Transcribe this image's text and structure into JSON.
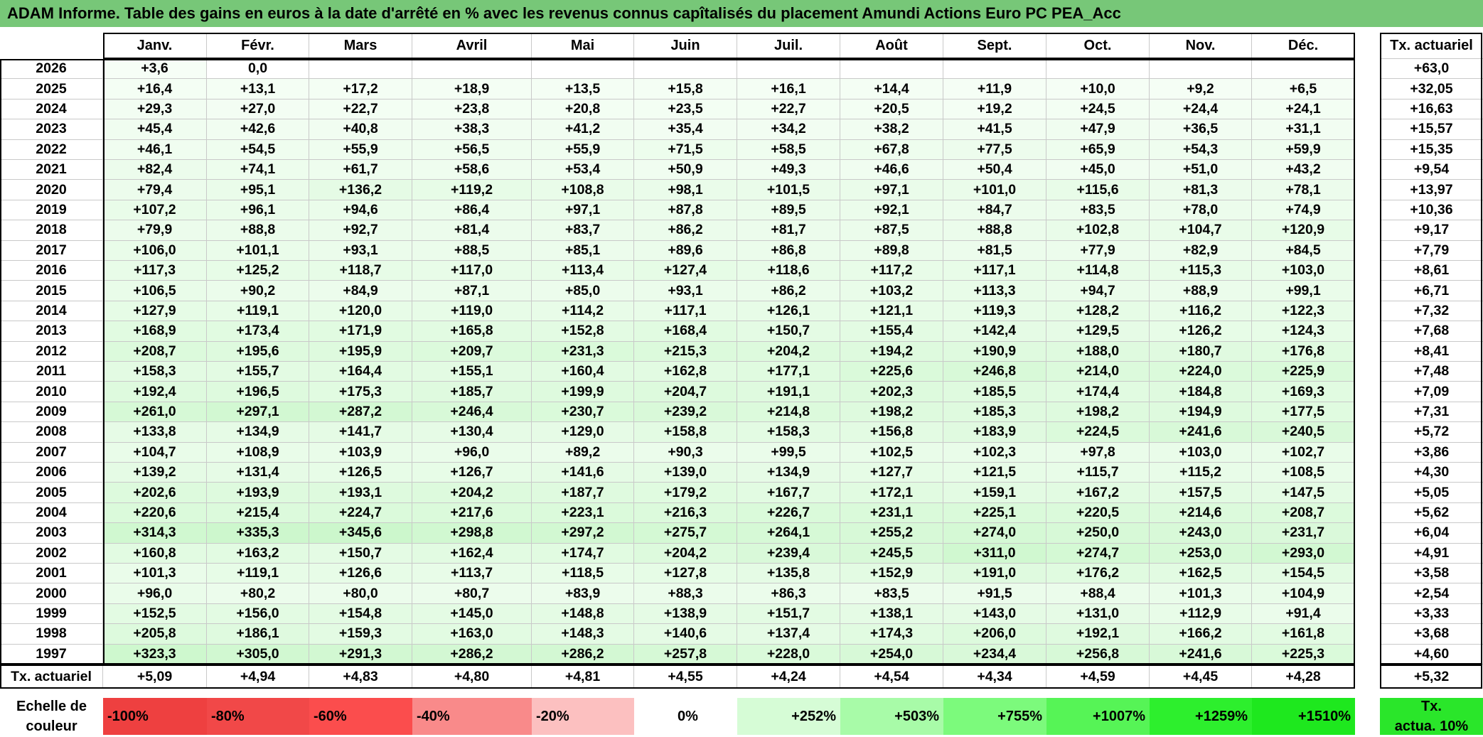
{
  "title": "ADAM Informe. Table des gains en euros à la date d'arrêté en % avec les revenus connus capîtalisés du placement Amundi Actions Euro PC PEA_Acc",
  "months": [
    "Janv.",
    "Févr.",
    "Mars",
    "Avril",
    "Mai",
    "Juin",
    "Juil.",
    "Août",
    "Sept.",
    "Oct.",
    "Nov.",
    "Déc."
  ],
  "rate_header": "Tx. actuariel",
  "footer_label": "Tx. actuariel",
  "rows": [
    {
      "year": "2026",
      "values": [
        "+3,6",
        "0,0",
        "",
        "",
        "",
        "",
        "",
        "",
        "",
        "",
        "",
        ""
      ],
      "rate": "+63,0"
    },
    {
      "year": "2025",
      "values": [
        "+16,4",
        "+13,1",
        "+17,2",
        "+18,9",
        "+13,5",
        "+15,8",
        "+16,1",
        "+14,4",
        "+11,9",
        "+10,0",
        "+9,2",
        "+6,5"
      ],
      "rate": "+32,05"
    },
    {
      "year": "2024",
      "values": [
        "+29,3",
        "+27,0",
        "+22,7",
        "+23,8",
        "+20,8",
        "+23,5",
        "+22,7",
        "+20,5",
        "+19,2",
        "+24,5",
        "+24,4",
        "+24,1"
      ],
      "rate": "+16,63"
    },
    {
      "year": "2023",
      "values": [
        "+45,4",
        "+42,6",
        "+40,8",
        "+38,3",
        "+41,2",
        "+35,4",
        "+34,2",
        "+38,2",
        "+41,5",
        "+47,9",
        "+36,5",
        "+31,1"
      ],
      "rate": "+15,57"
    },
    {
      "year": "2022",
      "values": [
        "+46,1",
        "+54,5",
        "+55,9",
        "+56,5",
        "+55,9",
        "+71,5",
        "+58,5",
        "+67,8",
        "+77,5",
        "+65,9",
        "+54,3",
        "+59,9"
      ],
      "rate": "+15,35"
    },
    {
      "year": "2021",
      "values": [
        "+82,4",
        "+74,1",
        "+61,7",
        "+58,6",
        "+53,4",
        "+50,9",
        "+49,3",
        "+46,6",
        "+50,4",
        "+45,0",
        "+51,0",
        "+43,2"
      ],
      "rate": "+9,54"
    },
    {
      "year": "2020",
      "values": [
        "+79,4",
        "+95,1",
        "+136,2",
        "+119,2",
        "+108,8",
        "+98,1",
        "+101,5",
        "+97,1",
        "+101,0",
        "+115,6",
        "+81,3",
        "+78,1"
      ],
      "rate": "+13,97"
    },
    {
      "year": "2019",
      "values": [
        "+107,2",
        "+96,1",
        "+94,6",
        "+86,4",
        "+97,1",
        "+87,8",
        "+89,5",
        "+92,1",
        "+84,7",
        "+83,5",
        "+78,0",
        "+74,9"
      ],
      "rate": "+10,36"
    },
    {
      "year": "2018",
      "values": [
        "+79,9",
        "+88,8",
        "+92,7",
        "+81,4",
        "+83,7",
        "+86,2",
        "+81,7",
        "+87,5",
        "+88,8",
        "+102,8",
        "+104,7",
        "+120,9"
      ],
      "rate": "+9,17"
    },
    {
      "year": "2017",
      "values": [
        "+106,0",
        "+101,1",
        "+93,1",
        "+88,5",
        "+85,1",
        "+89,6",
        "+86,8",
        "+89,8",
        "+81,5",
        "+77,9",
        "+82,9",
        "+84,5"
      ],
      "rate": "+7,79"
    },
    {
      "year": "2016",
      "values": [
        "+117,3",
        "+125,2",
        "+118,7",
        "+117,0",
        "+113,4",
        "+127,4",
        "+118,6",
        "+117,2",
        "+117,1",
        "+114,8",
        "+115,3",
        "+103,0"
      ],
      "rate": "+8,61"
    },
    {
      "year": "2015",
      "values": [
        "+106,5",
        "+90,2",
        "+84,9",
        "+87,1",
        "+85,0",
        "+93,1",
        "+86,2",
        "+103,2",
        "+113,3",
        "+94,7",
        "+88,9",
        "+99,1"
      ],
      "rate": "+6,71"
    },
    {
      "year": "2014",
      "values": [
        "+127,9",
        "+119,1",
        "+120,0",
        "+119,0",
        "+114,2",
        "+117,1",
        "+126,1",
        "+121,1",
        "+119,3",
        "+128,2",
        "+116,2",
        "+122,3"
      ],
      "rate": "+7,32"
    },
    {
      "year": "2013",
      "values": [
        "+168,9",
        "+173,4",
        "+171,9",
        "+165,8",
        "+152,8",
        "+168,4",
        "+150,7",
        "+155,4",
        "+142,4",
        "+129,5",
        "+126,2",
        "+124,3"
      ],
      "rate": "+7,68"
    },
    {
      "year": "2012",
      "values": [
        "+208,7",
        "+195,6",
        "+195,9",
        "+209,7",
        "+231,3",
        "+215,3",
        "+204,2",
        "+194,2",
        "+190,9",
        "+188,0",
        "+180,7",
        "+176,8"
      ],
      "rate": "+8,41"
    },
    {
      "year": "2011",
      "values": [
        "+158,3",
        "+155,7",
        "+164,4",
        "+155,1",
        "+160,4",
        "+162,8",
        "+177,1",
        "+225,6",
        "+246,8",
        "+214,0",
        "+224,0",
        "+225,9"
      ],
      "rate": "+7,48"
    },
    {
      "year": "2010",
      "values": [
        "+192,4",
        "+196,5",
        "+175,3",
        "+185,7",
        "+199,9",
        "+204,7",
        "+191,1",
        "+202,3",
        "+185,5",
        "+174,4",
        "+184,8",
        "+169,3"
      ],
      "rate": "+7,09"
    },
    {
      "year": "2009",
      "values": [
        "+261,0",
        "+297,1",
        "+287,2",
        "+246,4",
        "+230,7",
        "+239,2",
        "+214,8",
        "+198,2",
        "+185,3",
        "+198,2",
        "+194,9",
        "+177,5"
      ],
      "rate": "+7,31"
    },
    {
      "year": "2008",
      "values": [
        "+133,8",
        "+134,9",
        "+141,7",
        "+130,4",
        "+129,0",
        "+158,8",
        "+158,3",
        "+156,8",
        "+183,9",
        "+224,5",
        "+241,6",
        "+240,5"
      ],
      "rate": "+5,72"
    },
    {
      "year": "2007",
      "values": [
        "+104,7",
        "+108,9",
        "+103,9",
        "+96,0",
        "+89,2",
        "+90,3",
        "+99,5",
        "+102,5",
        "+102,3",
        "+97,8",
        "+103,0",
        "+102,7"
      ],
      "rate": "+3,86"
    },
    {
      "year": "2006",
      "values": [
        "+139,2",
        "+131,4",
        "+126,5",
        "+126,7",
        "+141,6",
        "+139,0",
        "+134,9",
        "+127,7",
        "+121,5",
        "+115,7",
        "+115,2",
        "+108,5"
      ],
      "rate": "+4,30"
    },
    {
      "year": "2005",
      "values": [
        "+202,6",
        "+193,9",
        "+193,1",
        "+204,2",
        "+187,7",
        "+179,2",
        "+167,7",
        "+172,1",
        "+159,1",
        "+167,2",
        "+157,5",
        "+147,5"
      ],
      "rate": "+5,05"
    },
    {
      "year": "2004",
      "values": [
        "+220,6",
        "+215,4",
        "+224,7",
        "+217,6",
        "+223,1",
        "+216,3",
        "+226,7",
        "+231,1",
        "+225,1",
        "+220,5",
        "+214,6",
        "+208,7"
      ],
      "rate": "+5,62"
    },
    {
      "year": "2003",
      "values": [
        "+314,3",
        "+335,3",
        "+345,6",
        "+298,8",
        "+297,2",
        "+275,7",
        "+264,1",
        "+255,2",
        "+274,0",
        "+250,0",
        "+243,0",
        "+231,7"
      ],
      "rate": "+6,04"
    },
    {
      "year": "2002",
      "values": [
        "+160,8",
        "+163,2",
        "+150,7",
        "+162,4",
        "+174,7",
        "+204,2",
        "+239,4",
        "+245,5",
        "+311,0",
        "+274,7",
        "+253,0",
        "+293,0"
      ],
      "rate": "+4,91"
    },
    {
      "year": "2001",
      "values": [
        "+101,3",
        "+119,1",
        "+126,6",
        "+113,7",
        "+118,5",
        "+127,8",
        "+135,8",
        "+152,9",
        "+191,0",
        "+176,2",
        "+162,5",
        "+154,5"
      ],
      "rate": "+3,58"
    },
    {
      "year": "2000",
      "values": [
        "+96,0",
        "+80,2",
        "+80,0",
        "+80,7",
        "+83,9",
        "+88,3",
        "+86,3",
        "+83,5",
        "+91,5",
        "+88,4",
        "+101,3",
        "+104,9"
      ],
      "rate": "+2,54"
    },
    {
      "year": "1999",
      "values": [
        "+152,5",
        "+156,0",
        "+154,8",
        "+145,0",
        "+148,8",
        "+138,9",
        "+151,7",
        "+138,1",
        "+143,0",
        "+131,0",
        "+112,9",
        "+91,4"
      ],
      "rate": "+3,33"
    },
    {
      "year": "1998",
      "values": [
        "+205,8",
        "+186,1",
        "+159,3",
        "+163,0",
        "+148,3",
        "+140,6",
        "+137,4",
        "+174,3",
        "+206,0",
        "+192,1",
        "+166,2",
        "+161,8"
      ],
      "rate": "+3,68"
    },
    {
      "year": "1997",
      "values": [
        "+323,3",
        "+305,0",
        "+291,3",
        "+286,2",
        "+286,2",
        "+257,8",
        "+228,0",
        "+254,0",
        "+234,4",
        "+256,8",
        "+241,6",
        "+225,3"
      ],
      "rate": "+4,60"
    }
  ],
  "footer_values": [
    "+5,09",
    "+4,94",
    "+4,83",
    "+4,80",
    "+4,81",
    "+4,55",
    "+4,24",
    "+4,54",
    "+4,34",
    "+4,59",
    "+4,45",
    "+4,28"
  ],
  "footer_rate": "+5,32",
  "legend": {
    "label_line1": "Echelle de",
    "label_line2": "couleur",
    "swatches": [
      {
        "label": "-100%",
        "color": "#ee4040"
      },
      {
        "label": "-80%",
        "color": "#f14848"
      },
      {
        "label": "-60%",
        "color": "#fb4d4d"
      },
      {
        "label": "-40%",
        "color": "#f98a8a"
      },
      {
        "label": "-20%",
        "color": "#fcc0c0"
      },
      {
        "label": "0%",
        "color": "#ffffff"
      },
      {
        "label": "+252%",
        "color": "#d6fcd6"
      },
      {
        "label": "+503%",
        "color": "#a8fba8"
      },
      {
        "label": "+755%",
        "color": "#7cfa7c"
      },
      {
        "label": "+1007%",
        "color": "#56f456"
      },
      {
        "label": "+1259%",
        "color": "#2def2d"
      },
      {
        "label": "+1510%",
        "color": "#1ee81e"
      }
    ],
    "rate_line1": "Tx.",
    "rate_line2": "actua. 10%",
    "rate_color": "#2ae62a"
  }
}
